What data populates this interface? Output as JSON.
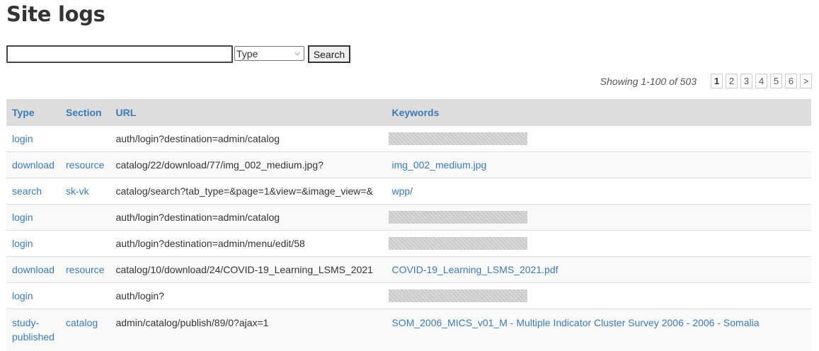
{
  "page": {
    "title": "Site logs"
  },
  "search": {
    "placeholder": "",
    "value": "",
    "type_selected": "Type",
    "button_label": "Search"
  },
  "pager": {
    "showing": "Showing 1-100 of 503",
    "pages": [
      "1",
      "2",
      "3",
      "4",
      "5",
      "6"
    ],
    "active": "1",
    "next": ">"
  },
  "table": {
    "headers": [
      "Type",
      "Section",
      "URL",
      "Keywords"
    ],
    "rows": [
      {
        "type": "login",
        "section": "",
        "url": "auth/login?destination=admin/catalog",
        "keywords": "",
        "keywords_blurred": true
      },
      {
        "type": "download",
        "section": "resource",
        "url": "catalog/22/download/77/img_002_medium.jpg?",
        "keywords": "img_002_medium.jpg",
        "keywords_blurred": false
      },
      {
        "type": "search",
        "section": "sk-vk",
        "url": "catalog/search?tab_type=&page=1&view=&image_view=&",
        "keywords": "wpp/",
        "keywords_blurred": false
      },
      {
        "type": "login",
        "section": "",
        "url": "auth/login?destination=admin/catalog",
        "keywords": "",
        "keywords_blurred": true
      },
      {
        "type": "login",
        "section": "",
        "url": "auth/login?destination=admin/menu/edit/58",
        "keywords": "",
        "keywords_blurred": true
      },
      {
        "type": "download",
        "section": "resource",
        "url": "catalog/10/download/24/COVID-19_Learning_LSMS_2021",
        "keywords": "COVID-19_Learning_LSMS_2021.pdf",
        "keywords_blurred": false
      },
      {
        "type": "login",
        "section": "",
        "url": "auth/login?",
        "keywords": "",
        "keywords_blurred": true
      },
      {
        "type": "study-published",
        "section": "catalog",
        "url": "admin/catalog/publish/89/0?ajax=1",
        "keywords": "SOM_2006_MICS_v01_M - Multiple Indicator Cluster Survey 2006 - 2006 - Somalia",
        "keywords_blurred": false
      }
    ]
  }
}
